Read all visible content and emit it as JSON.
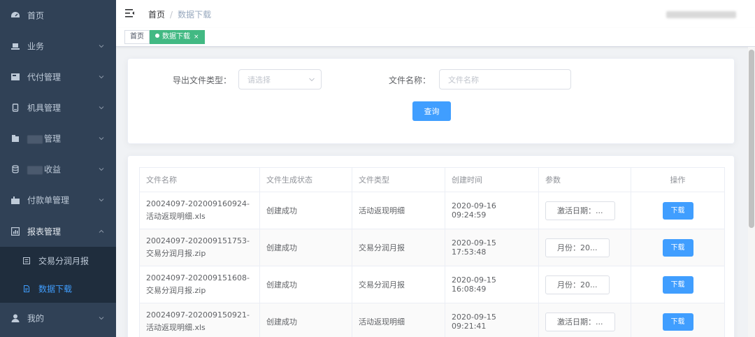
{
  "sidebar": {
    "items": [
      {
        "label": "首页",
        "icon": "dashboard-icon"
      },
      {
        "label": "业务",
        "icon": "business-icon"
      },
      {
        "label": "代付管理",
        "icon": "payment-icon"
      },
      {
        "label": "机具管理",
        "icon": "device-icon"
      },
      {
        "label": "管理",
        "icon": "folder-icon"
      },
      {
        "label": "收益",
        "icon": "database-icon"
      },
      {
        "label": "付款单管理",
        "icon": "invoice-icon"
      },
      {
        "label": "报表管理",
        "icon": "chart-icon"
      },
      {
        "label": "我的",
        "icon": "user-icon"
      }
    ],
    "submenu": [
      {
        "label": "交易分润月报"
      },
      {
        "label": "数据下载"
      }
    ]
  },
  "navbar": {
    "breadcrumb_home": "首页",
    "breadcrumb_sep": "/",
    "breadcrumb_current": "数据下载"
  },
  "tags": {
    "home": "首页",
    "active": "数据下载",
    "close": "×"
  },
  "filter": {
    "file_type_label": "导出文件类型：",
    "file_type_placeholder": "请选择",
    "file_name_label": "文件名称：",
    "file_name_placeholder": "文件名称",
    "query_label": "查询"
  },
  "table": {
    "headers": [
      "文件名称",
      "文件生成状态",
      "文件类型",
      "创建时间",
      "参数",
      "操作"
    ],
    "rows": [
      {
        "name": "20024097-202009160924-活动返现明细.xls",
        "status": "创建成功",
        "type": "活动返现明细",
        "time": "2020-09-16 09:24:59",
        "param": "激活日期：...",
        "action": "下载"
      },
      {
        "name": "20024097-202009151753-交易分润月报.zip",
        "status": "创建成功",
        "type": "交易分润月报",
        "time": "2020-09-15 17:53:48",
        "param": "月份：20...",
        "action": "下载"
      },
      {
        "name": "20024097-202009151608-交易分润月报.zip",
        "status": "创建成功",
        "type": "交易分润月报",
        "time": "2020-09-15 16:08:49",
        "param": "月份：20...",
        "action": "下载"
      },
      {
        "name": "20024097-202009150921-活动返现明细.xls",
        "status": "创建成功",
        "type": "活动返现明细",
        "time": "2020-09-15 09:21:41",
        "param": "激活日期：...",
        "action": "下载"
      }
    ]
  },
  "colors": {
    "sidebar_bg": "#304156",
    "submenu_bg": "#1f2d3d",
    "accent": "#409eff",
    "tag_active": "#42b983"
  }
}
